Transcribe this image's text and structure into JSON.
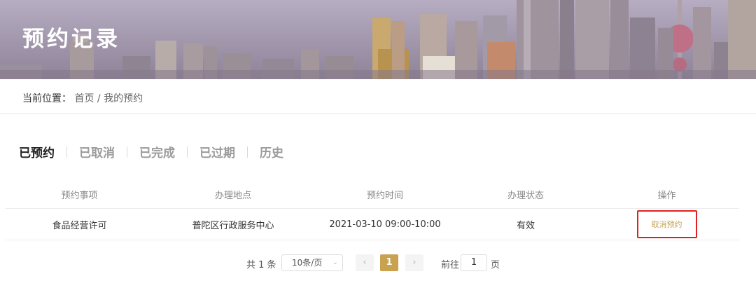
{
  "banner": {
    "title": "预约记录"
  },
  "breadcrumb": {
    "label": "当前位置：",
    "home": "首页",
    "separator": "/",
    "current": "我的预约"
  },
  "tabs": [
    {
      "label": "已预约",
      "active": true
    },
    {
      "label": "已取消",
      "active": false
    },
    {
      "label": "已完成",
      "active": false
    },
    {
      "label": "已过期",
      "active": false
    },
    {
      "label": "历史",
      "active": false
    }
  ],
  "table": {
    "headers": [
      "预约事项",
      "办理地点",
      "预约时间",
      "办理状态",
      "操作"
    ],
    "rows": [
      {
        "item": "食品经营许可",
        "location": "普陀区行政服务中心",
        "time": "2021-03-10 09:00-10:00",
        "status": "有效",
        "action": "取消预约"
      }
    ]
  },
  "pagination": {
    "total": "共 1 条",
    "page_size": "10条/页",
    "prev_icon": "chevron-left-icon",
    "next_icon": "chevron-right-icon",
    "current_page": "1",
    "goto_label": "前往",
    "goto_value": "1",
    "page_suffix": "页"
  },
  "colors": {
    "accent": "#c9a24f",
    "highlight_border": "#e02020"
  }
}
